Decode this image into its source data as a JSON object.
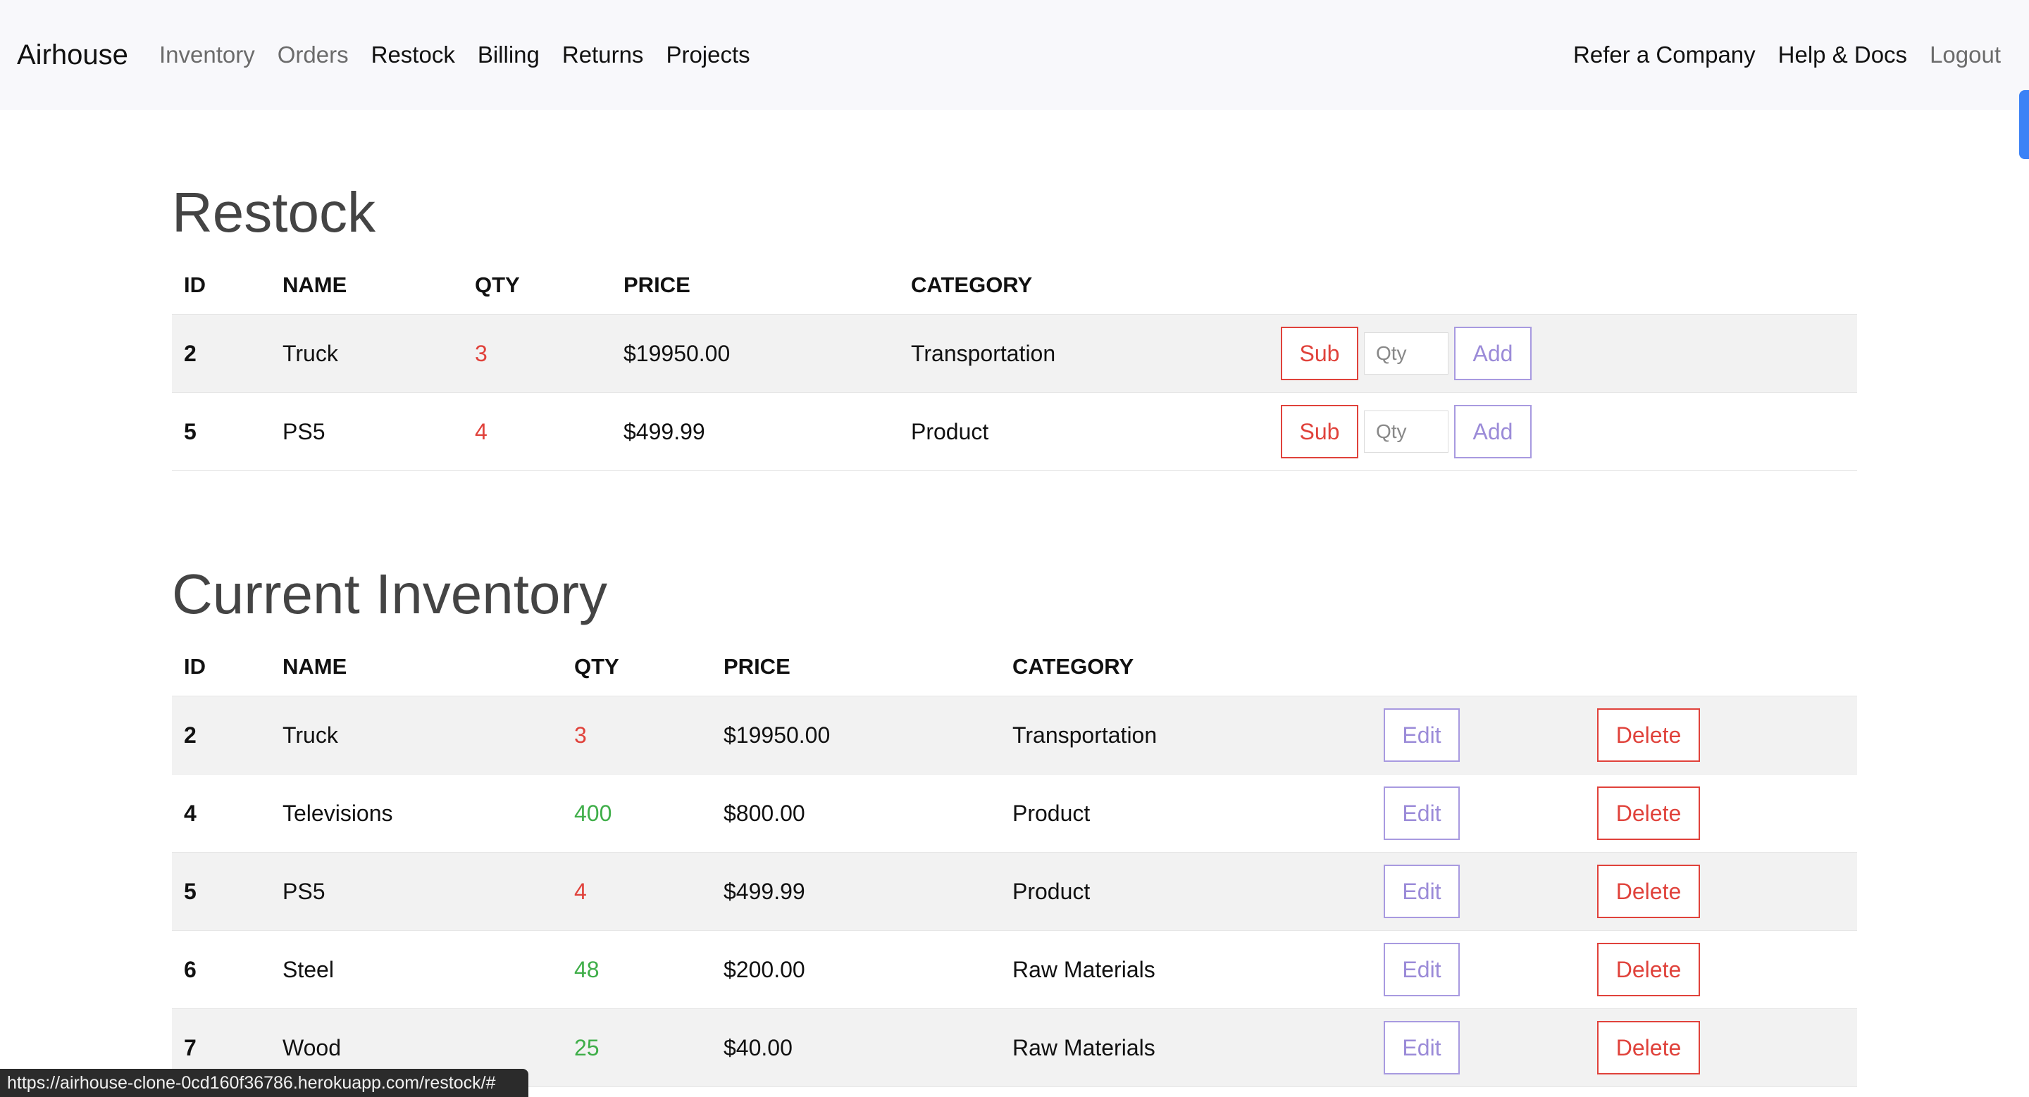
{
  "navbar": {
    "brand": "Airhouse",
    "links": [
      {
        "label": "Inventory"
      },
      {
        "label": "Orders"
      },
      {
        "label": "Restock"
      },
      {
        "label": "Billing"
      },
      {
        "label": "Returns"
      },
      {
        "label": "Projects"
      }
    ],
    "right_links": [
      {
        "label": "Refer a Company"
      },
      {
        "label": "Help & Docs"
      },
      {
        "label": "Logout"
      }
    ]
  },
  "restock": {
    "title": "Restock",
    "headers": {
      "id": "ID",
      "name": "NAME",
      "qty": "QTY",
      "price": "PRICE",
      "category": "CATEGORY"
    },
    "sub_label": "Sub",
    "add_label": "Add",
    "qty_placeholder": "Qty",
    "rows": [
      {
        "id": "2",
        "name": "Truck",
        "qty": "3",
        "price": "$19950.00",
        "category": "Transportation"
      },
      {
        "id": "5",
        "name": "PS5",
        "qty": "4",
        "price": "$499.99",
        "category": "Product"
      }
    ]
  },
  "inventory": {
    "title": "Current Inventory",
    "headers": {
      "id": "ID",
      "name": "NAME",
      "qty": "QTY",
      "price": "PRICE",
      "category": "CATEGORY"
    },
    "edit_label": "Edit",
    "delete_label": "Delete",
    "rows": [
      {
        "id": "2",
        "name": "Truck",
        "qty": "3",
        "price": "$19950.00",
        "category": "Transportation"
      },
      {
        "id": "4",
        "name": "Televisions",
        "qty": "400",
        "price": "$800.00",
        "category": "Product"
      },
      {
        "id": "5",
        "name": "PS5",
        "qty": "4",
        "price": "$499.99",
        "category": "Product"
      },
      {
        "id": "6",
        "name": "Steel",
        "qty": "48",
        "price": "$200.00",
        "category": "Raw Materials"
      },
      {
        "id": "7",
        "name": "Wood",
        "qty": "25",
        "price": "$40.00",
        "category": "Raw Materials"
      }
    ]
  },
  "status_bar": {
    "url": "https://airhouse-clone-0cd160f36786.herokuapp.com/restock/#"
  },
  "colors": {
    "low_qty": "#e0423b",
    "ok_qty": "#3fae49",
    "danger": "#e0423b",
    "primary_outline": "#9b8bd8",
    "navbar_bg": "#f8f8fb"
  }
}
